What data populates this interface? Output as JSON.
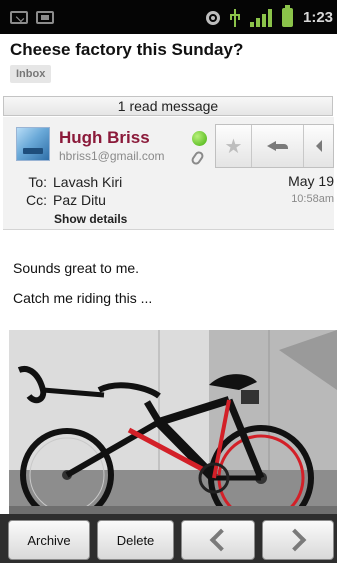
{
  "status_bar": {
    "time": "1:23",
    "icons": [
      "gmail-notification-icon",
      "picture-notification-icon",
      "gps-icon",
      "usb-icon",
      "signal-icon",
      "battery-icon"
    ],
    "accent_color": "#8bc34a"
  },
  "conversation": {
    "subject": "Cheese factory this Sunday?",
    "label": "Inbox",
    "read_messages": "1 read message"
  },
  "message": {
    "sender_name": "Hugh Briss",
    "sender_email": "hbriss1@gmail.com",
    "sender_color": "#8b1a3a",
    "presence": "online",
    "has_attachment": true,
    "to_label": "To:",
    "to": "Lavash Kiri",
    "cc_label": "Cc:",
    "cc": "Paz Ditu",
    "show_details": "Show details",
    "date": "May 19",
    "time": "10:58am",
    "body": [
      "Sounds great to me.",
      "Catch me riding this ..."
    ],
    "attachment_image": "bicycle-photo"
  },
  "bottom_bar": {
    "archive": "Archive",
    "delete": "Delete",
    "prev_icon": "chevron-left-icon",
    "next_icon": "chevron-right-icon"
  }
}
